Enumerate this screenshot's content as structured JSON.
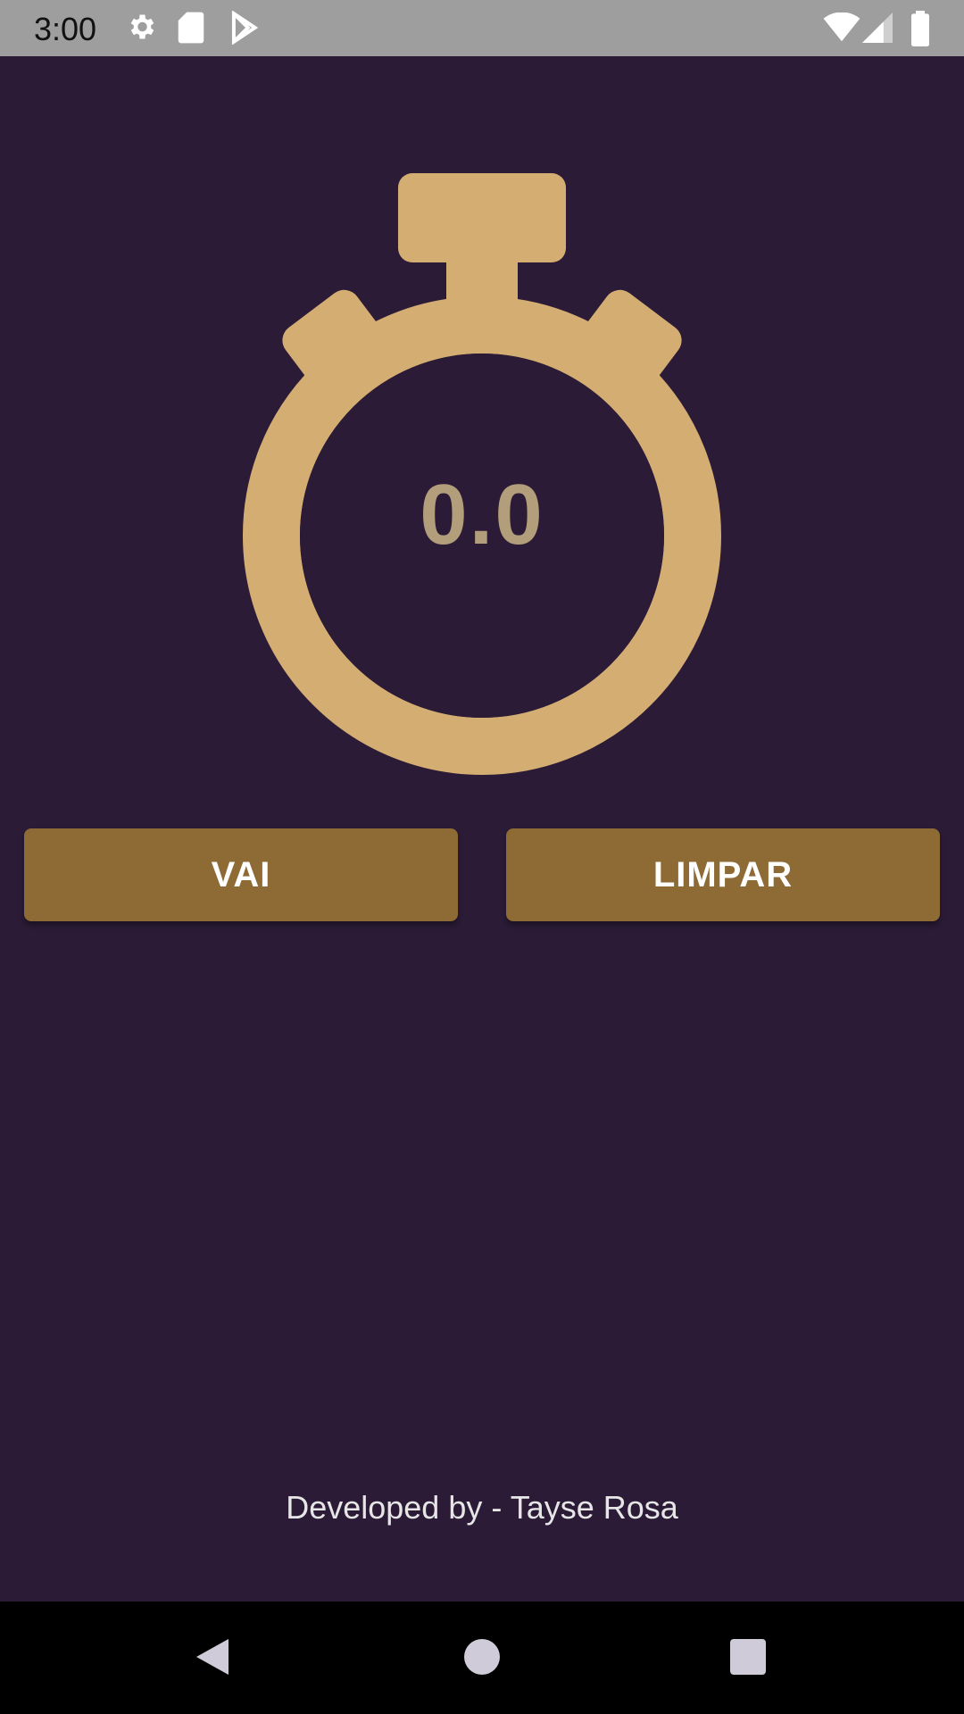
{
  "status_bar": {
    "time": "3:00",
    "icons": [
      "gear-icon",
      "sd-card-icon",
      "play-store-icon",
      "wifi-icon",
      "signal-icon",
      "battery-icon"
    ]
  },
  "stopwatch": {
    "display_value": "0.0",
    "icon": "stopwatch-icon"
  },
  "buttons": {
    "go_label": "VAI",
    "clear_label": "LIMPAR"
  },
  "footer": {
    "credit": "Developed by - Tayse Rosa"
  },
  "nav_bar": {
    "items": [
      "back-icon",
      "home-icon",
      "recents-icon"
    ]
  },
  "colors": {
    "background": "#2b1b36",
    "accent": "#d4ad72",
    "button": "#8e6a34",
    "timer_text": "#b29e7a"
  }
}
